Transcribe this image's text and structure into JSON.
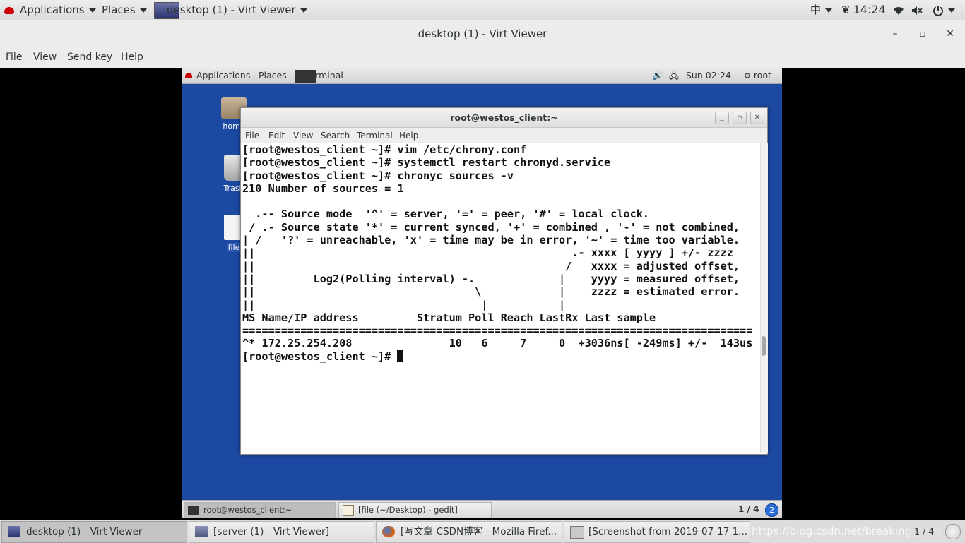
{
  "host_top": {
    "applications": "Applications",
    "places": "Places",
    "window_task": "desktop (1) - Virt Viewer",
    "ime": "中",
    "time": "14:24"
  },
  "window": {
    "title": "desktop (1) - Virt Viewer",
    "minimize": "–",
    "maximize": "▫",
    "close": "✕"
  },
  "menu": {
    "file": "File",
    "view": "View",
    "send_key": "Send key",
    "help": "Help"
  },
  "guest": {
    "top": {
      "applications": "Applications",
      "places": "Places",
      "terminal": "Terminal",
      "clock": "Sun 02:24",
      "user": "root"
    },
    "desktop_icons": {
      "home": "home",
      "trash": "Trash",
      "file": "file"
    },
    "terminal": {
      "title": "root@westos_client:~",
      "menu": {
        "file": "File",
        "edit": "Edit",
        "view": "View",
        "search": "Search",
        "terminal": "Terminal",
        "help": "Help"
      },
      "lines": [
        "[root@westos_client ~]# vim /etc/chrony.conf",
        "[root@westos_client ~]# systemctl restart chronyd.service",
        "[root@westos_client ~]# chronyc sources -v",
        "210 Number of sources = 1",
        "",
        "  .-- Source mode  '^' = server, '=' = peer, '#' = local clock.",
        " / .- Source state '*' = current synced, '+' = combined , '-' = not combined,",
        "| /   '?' = unreachable, 'x' = time may be in error, '~' = time too variable.",
        "||                                                 .- xxxx [ yyyy ] +/- zzzz",
        "||                                                /   xxxx = adjusted offset,",
        "||         Log2(Polling interval) -.             |    yyyy = measured offset,",
        "||                                  \\            |    zzzz = estimated error.",
        "||                                   |           |",
        "MS Name/IP address         Stratum Poll Reach LastRx Last sample",
        "===============================================================================",
        "^* 172.25.254.208               10   6     7     0  +3036ns[ -249ms] +/-  143us"
      ],
      "prompt": "[root@westos_client ~]# "
    },
    "bottom": {
      "task1": "root@westos_client:~",
      "task2": "[file (~/Desktop) - gedit]",
      "workspace": "1 / 4"
    }
  },
  "host_bottom": {
    "task1": "desktop (1) - Virt Viewer",
    "task2": "[server (1) - Virt Viewer]",
    "task3": "[写文章-CSDN博客 - Mozilla Firef...",
    "task4": "[Screenshot from 2019-07-17 1...",
    "watermark": "https://blog.csdn.net/breaking_nerd",
    "workspace": "1 / 4"
  },
  "colors": {
    "guest_desktop": "#1c4aa3",
    "panel": "#dcdcdc"
  }
}
